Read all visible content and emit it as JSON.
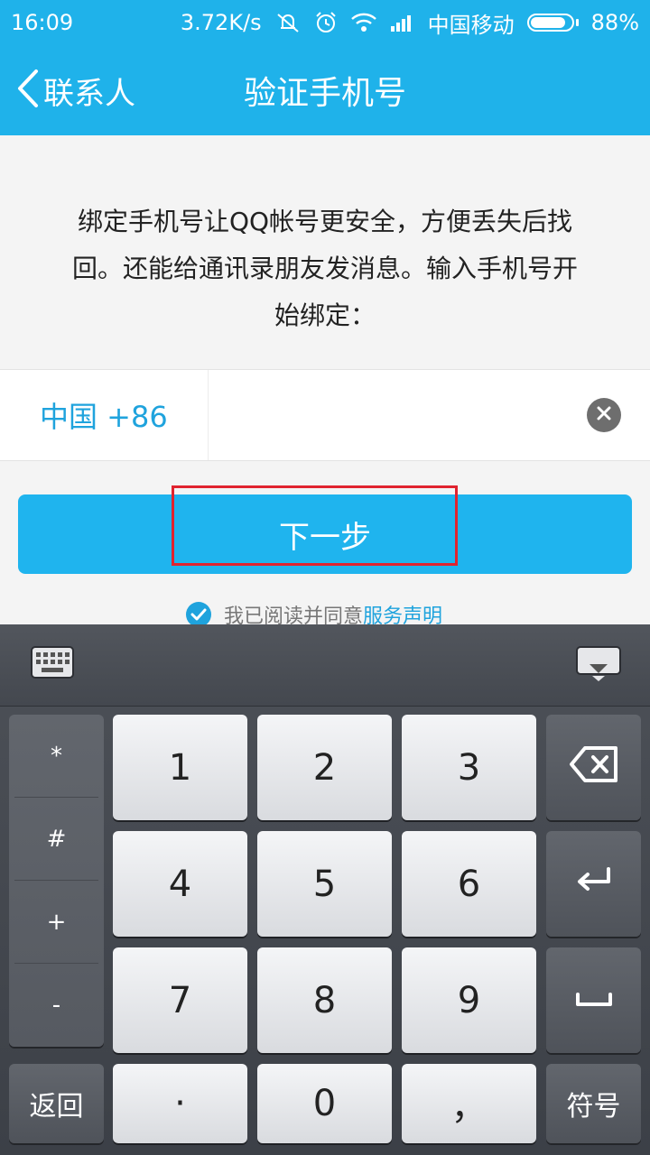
{
  "status_bar": {
    "time": "16:09",
    "speed": "3.72K/s",
    "carrier": "中国移动",
    "battery_percent": "88%",
    "battery_level": 0.88,
    "icons": [
      "mute-icon",
      "alarm-icon",
      "wifi-icon",
      "signal-icon",
      "battery-icon"
    ]
  },
  "nav": {
    "back_label": "联系人",
    "title": "验证手机号"
  },
  "content": {
    "description_lines": [
      "绑定手机号让QQ帐号更安全，方便丢失后找",
      "回。还能给通讯录朋友发消息。输入手机号开",
      "始绑定："
    ],
    "country_code": "中国 +86",
    "phone_value": "",
    "phone_placeholder": "",
    "next_label": "下一步",
    "agreement_text": "我已阅读并同意",
    "agreement_link": "服务声明",
    "agreement_checked": true
  },
  "colors": {
    "accent": "#1fb2ea",
    "button": "#1fb4ee",
    "highlight": "#e0232f"
  },
  "keyboard": {
    "toolbar_left_icon": "keyboard-switch-icon",
    "toolbar_right_icon": "keyboard-hide-icon",
    "symbols": [
      "*",
      "#",
      "+",
      "-"
    ],
    "digits": [
      "1",
      "2",
      "3",
      "4",
      "5",
      "6",
      "7",
      "8",
      "9"
    ],
    "bottom_row": [
      "返回",
      "·",
      "0",
      "，",
      "符号"
    ],
    "side_icons": [
      "backspace-icon",
      "enter-icon",
      "space-icon"
    ]
  }
}
